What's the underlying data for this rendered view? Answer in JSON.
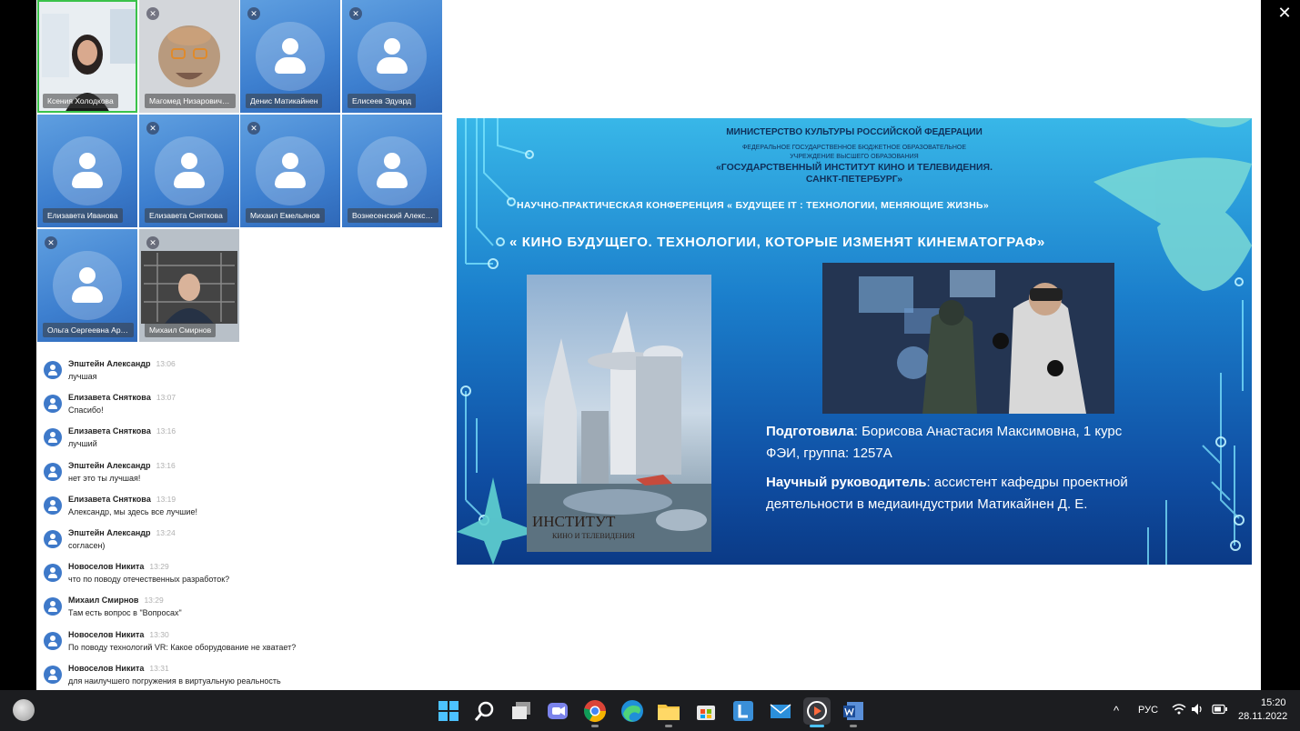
{
  "window": {
    "close_symbol": "✕"
  },
  "participants": [
    {
      "name": "Ксения Холодкова",
      "video": true,
      "active": true,
      "muted": false
    },
    {
      "name": "Магомед Низарович М...",
      "video": true,
      "muted": true
    },
    {
      "name": "Денис Матикайнен",
      "video": false,
      "muted": true
    },
    {
      "name": "Елисеев Эдуард",
      "video": false,
      "muted": true
    },
    {
      "name": "Елизавета Иванова",
      "video": false,
      "muted": false
    },
    {
      "name": "Елизавета Снятковa",
      "video": false,
      "muted": true
    },
    {
      "name": "Михаил Емельянов",
      "video": false,
      "muted": true
    },
    {
      "name": "Вознесенский Алекса...",
      "video": false,
      "muted": false
    },
    {
      "name": "Ольга Сергеевна Арта...",
      "video": false,
      "muted": true
    },
    {
      "name": "Михаил Смирнов",
      "video": true,
      "muted": true
    }
  ],
  "chat": [
    {
      "author": "Эпштейн Александр",
      "time": "13:06",
      "text": "лучшая"
    },
    {
      "author": "Елизавета Снятковa",
      "time": "13:07",
      "text": "Спасибо!"
    },
    {
      "author": "Елизавета Снятковa",
      "time": "13:16",
      "text": "лучший"
    },
    {
      "author": "Эпштейн Александр",
      "time": "13:16",
      "text": "нет это ты лучшая!"
    },
    {
      "author": "Елизавета Снятковa",
      "time": "13:19",
      "text": "Александр, мы здесь все лучшие!"
    },
    {
      "author": "Эпштейн Александр",
      "time": "13:24",
      "text": "согласен)"
    },
    {
      "author": "Новоселов Никита",
      "time": "13:29",
      "text": "что по поводу отечественных разработок?"
    },
    {
      "author": "Михаил Смирнов",
      "time": "13:29",
      "text": "Там есть вопрос в \"Вопросах\""
    },
    {
      "author": "Новоселов Никита",
      "time": "13:30",
      "text": "По поводу технологий VR: Какое оборудование не хватает?"
    },
    {
      "author": "Новоселов Никита",
      "time": "13:31",
      "text": "для наилучшего погружения в виртуальную реальность"
    }
  ],
  "slide": {
    "ministry": "МИНИСТЕРСТВО КУЛЬТУРЫ РОССИЙСКОЙ ФЕДЕРАЦИИ",
    "fed_line1": "ФЕДЕРАЛЬНОЕ ГОСУДАРСТВЕННОЕ БЮДЖЕТНОЕ ОБРАЗОВАТЕЛЬНОЕ",
    "fed_line2": "УЧРЕЖДЕНИЕ ВЫСШЕГО ОБРАЗОВАНИЯ",
    "inst_line1": "«ГОСУДАРСТВЕННЫЙ ИНСТИТУТ КИНО И ТЕЛЕВИДЕНИЯ.",
    "inst_line2": "САНКТ-ПЕТЕРБУРГ»",
    "conference": "НАУЧНО-ПРАКТИЧЕСКАЯ КОНФЕРЕНЦИЯ  « БУДУЩЕЕ IT : ТЕХНОЛОГИИ,  МЕНЯЮЩИЕ  ЖИЗНЬ»",
    "title": "« КИНО БУДУЩЕГО. ТЕХНОЛОГИИ,  КОТОРЫЕ  ИЗМЕНЯТ  КИНЕМАТОГРАФ»",
    "prepared_label": "Подготовила",
    "prepared_text": ": Борисова Анастасия Максимовна, 1 курс",
    "prepared_text2": "ФЭИ, группа: 1257А",
    "lead_label": "Научный руководитель",
    "lead_text": ": ассистент кафедры проектной",
    "lead_text2": "деятельности в медиаиндустрии Матикайнен Д. Е.",
    "sign1": "ИНСТИТУТ",
    "sign2": "КИНО И ТЕЛЕВИДЕНИЯ"
  },
  "taskbar": {
    "language": "РУС",
    "time": "15:20",
    "date": "28.11.2022",
    "tray_arrow": "^"
  }
}
